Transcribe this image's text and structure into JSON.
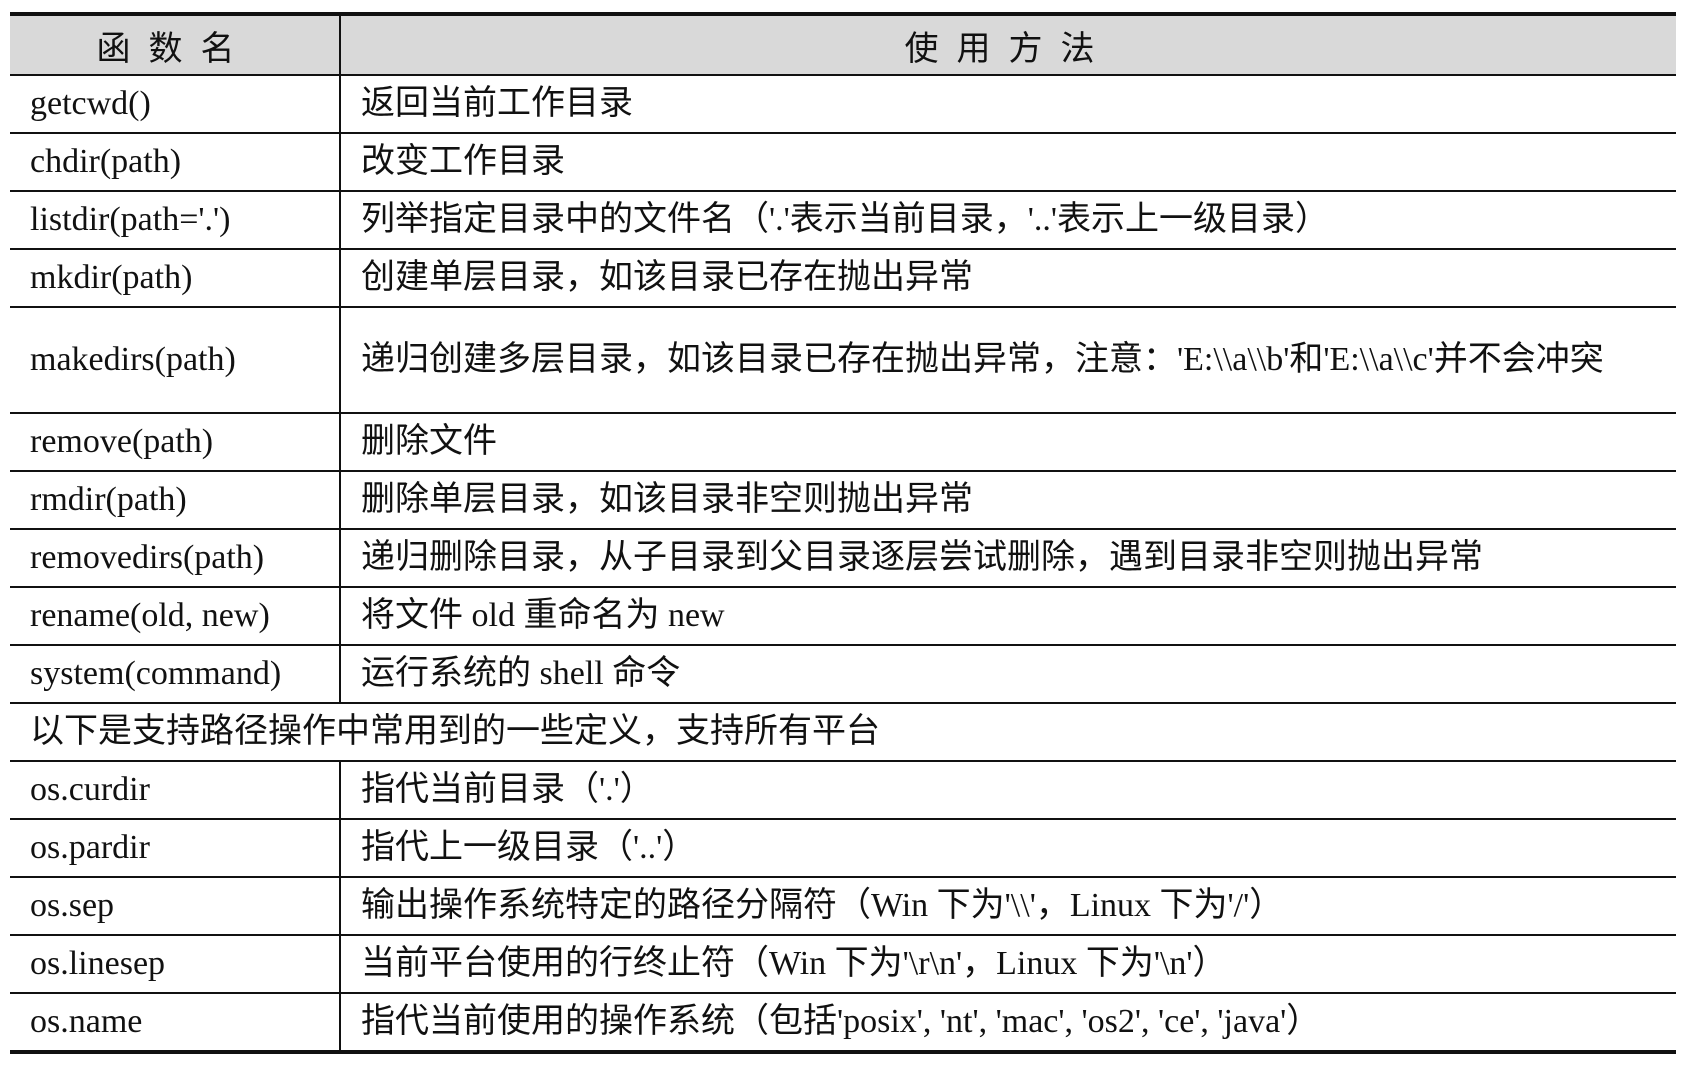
{
  "headers": {
    "name": "函数名",
    "usage": "使用方法"
  },
  "rows": [
    {
      "name": "getcwd()",
      "usage": "返回当前工作目录"
    },
    {
      "name": "chdir(path)",
      "usage": "改变工作目录"
    },
    {
      "name": "listdir(path='.')",
      "usage": "列举指定目录中的文件名（'.'表示当前目录，'..'表示上一级目录）"
    },
    {
      "name": "mkdir(path)",
      "usage": "创建单层目录，如该目录已存在抛出异常"
    },
    {
      "name": "makedirs(path)",
      "usage": "递归创建多层目录，如该目录已存在抛出异常，注意：'E:\\\\a\\\\b'和'E:\\\\a\\\\c'并不会冲突"
    },
    {
      "name": "remove(path)",
      "usage": "删除文件"
    },
    {
      "name": "rmdir(path)",
      "usage": "删除单层目录，如该目录非空则抛出异常"
    },
    {
      "name": "removedirs(path)",
      "usage": "递归删除目录，从子目录到父目录逐层尝试删除，遇到目录非空则抛出异常"
    },
    {
      "name": "rename(old, new)",
      "usage": "将文件 old 重命名为 new"
    },
    {
      "name": "system(command)",
      "usage": "运行系统的 shell 命令"
    }
  ],
  "section_note": "以下是支持路径操作中常用到的一些定义，支持所有平台",
  "definitions": [
    {
      "name": "os.curdir",
      "usage": "指代当前目录（'.'）"
    },
    {
      "name": "os.pardir",
      "usage": "指代上一级目录（'..'）"
    },
    {
      "name": "os.sep",
      "usage": "输出操作系统特定的路径分隔符（Win 下为'\\\\'，Linux 下为'/'）"
    },
    {
      "name": "os.linesep",
      "usage": "当前平台使用的行终止符（Win 下为'\\r\\n'，Linux 下为'\\n'）"
    },
    {
      "name": "os.name",
      "usage": "指代当前使用的操作系统（包括'posix', 'nt', 'mac', 'os2', 'ce', 'java'）"
    }
  ]
}
